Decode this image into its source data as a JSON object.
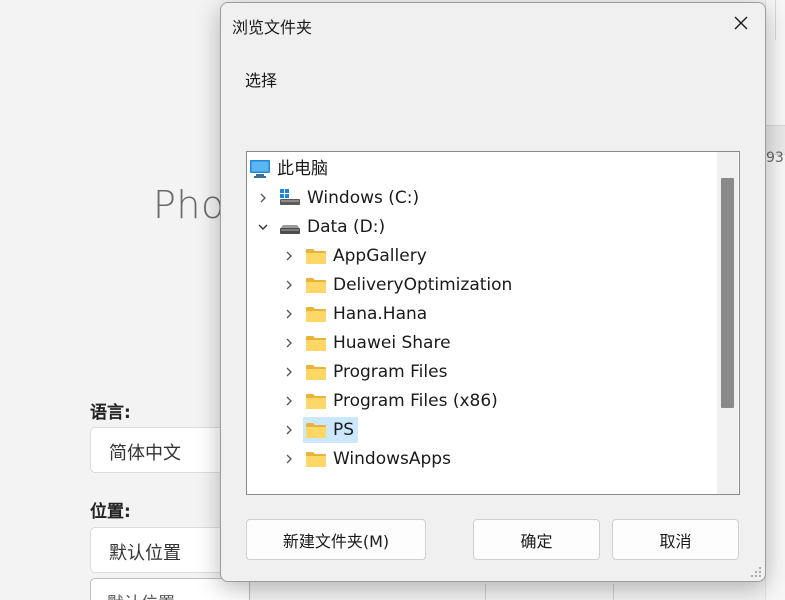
{
  "background": {
    "app_title_partial": "Pho",
    "language_label": "语言:",
    "language_value": "简体中文",
    "location_label": "位置:",
    "location_value": "默认位置",
    "path_value_partial": "默认位置",
    "right_panel_number": "93"
  },
  "dialog": {
    "title": "浏览文件夹",
    "description": "选择",
    "close_icon": "close-icon",
    "tree": [
      {
        "label": "此电脑",
        "icon": "computer-icon",
        "depth": 0,
        "expander": "none"
      },
      {
        "label": "Windows (C:)",
        "icon": "windows-drive-icon",
        "depth": 1,
        "expander": "collapsed"
      },
      {
        "label": "Data (D:)",
        "icon": "drive-icon",
        "depth": 1,
        "expander": "expanded"
      },
      {
        "label": "AppGallery",
        "icon": "folder-icon",
        "depth": 2,
        "expander": "collapsed"
      },
      {
        "label": "DeliveryOptimization",
        "icon": "folder-icon",
        "depth": 2,
        "expander": "collapsed"
      },
      {
        "label": "Hana.Hana",
        "icon": "folder-icon",
        "depth": 2,
        "expander": "collapsed"
      },
      {
        "label": "Huawei Share",
        "icon": "folder-icon",
        "depth": 2,
        "expander": "collapsed"
      },
      {
        "label": "Program Files",
        "icon": "folder-icon",
        "depth": 2,
        "expander": "collapsed"
      },
      {
        "label": "Program Files (x86)",
        "icon": "folder-icon",
        "depth": 2,
        "expander": "collapsed"
      },
      {
        "label": "PS",
        "icon": "folder-icon",
        "depth": 2,
        "expander": "collapsed",
        "selected": true
      },
      {
        "label": "WindowsApps",
        "icon": "folder-icon",
        "depth": 2,
        "expander": "collapsed"
      }
    ],
    "buttons": {
      "new_folder": "新建文件夹(M)",
      "ok": "确定",
      "cancel": "取消"
    },
    "colors": {
      "selection": "#cce8ff",
      "folder": "#ffd766",
      "folder_dark": "#e8b33a"
    }
  }
}
